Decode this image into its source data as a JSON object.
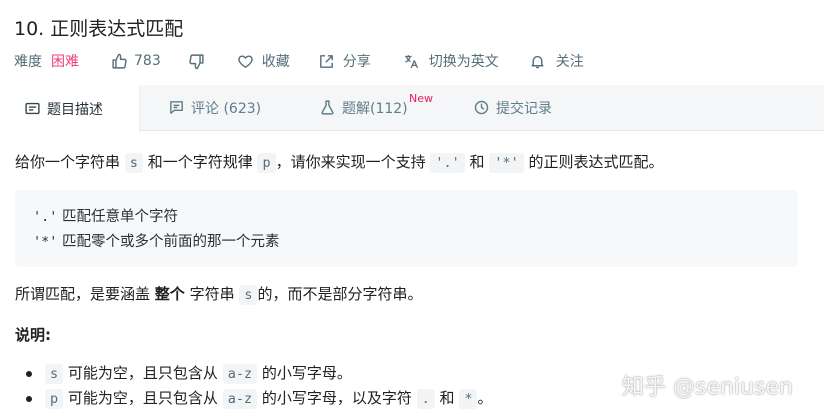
{
  "header": {
    "title": "10. 正则表达式匹配",
    "difficulty_label": "难度",
    "difficulty_value": "困难",
    "likes": "783",
    "favorite_label": "收藏",
    "share_label": "分享",
    "translate_label": "切换为英文",
    "follow_label": "关注"
  },
  "tabs": {
    "description": "题目描述",
    "comments": "评论 (623)",
    "solutions": "题解(112)",
    "solutions_badge": "New",
    "submissions": "提交记录"
  },
  "problem": {
    "intro_a": "给你一个字符串 ",
    "intro_s": "s",
    "intro_b": " 和一个字符规律 ",
    "intro_p": "p",
    "intro_c": "，请你来实现一个支持 ",
    "intro_dot": "'.'",
    "intro_d": " 和 ",
    "intro_star": "'*'",
    "intro_e": " 的正则表达式匹配。",
    "rule1_code": "'.'",
    "rule1_text": " 匹配任意单个字符",
    "rule2_code": "'*'",
    "rule2_text": " 匹配零个或多个前面的那一个元素",
    "match_a": "所谓匹配，是要涵盖 ",
    "match_bold": "整个",
    "match_b": " 字符串 ",
    "match_s": "s",
    "match_c": "的，而不是部分字符串。",
    "note_title": "说明:",
    "note1_code": "s",
    "note1_a": " 可能为空，且只包含从 ",
    "note1_range": "a-z",
    "note1_b": " 的小写字母。",
    "note2_code": "p",
    "note2_a": " 可能为空，且只包含从 ",
    "note2_range": "a-z",
    "note2_b": " 的小写字母，以及字符 ",
    "note2_dot": ".",
    "note2_c": " 和 ",
    "note2_star": "*",
    "note2_d": "。"
  },
  "watermark": "知乎 @seniusen",
  "colors": {
    "difficulty_hard": "#ec407a",
    "new_badge": "#e91e63",
    "tab_bar_bg": "#f5f6f7",
    "code_bg": "#f2f4f6"
  },
  "icons": [
    "thumbs-up-icon",
    "thumbs-down-icon",
    "heart-icon",
    "share-icon",
    "translate-icon",
    "bell-icon",
    "description-icon",
    "comment-icon",
    "flask-icon",
    "history-icon"
  ]
}
